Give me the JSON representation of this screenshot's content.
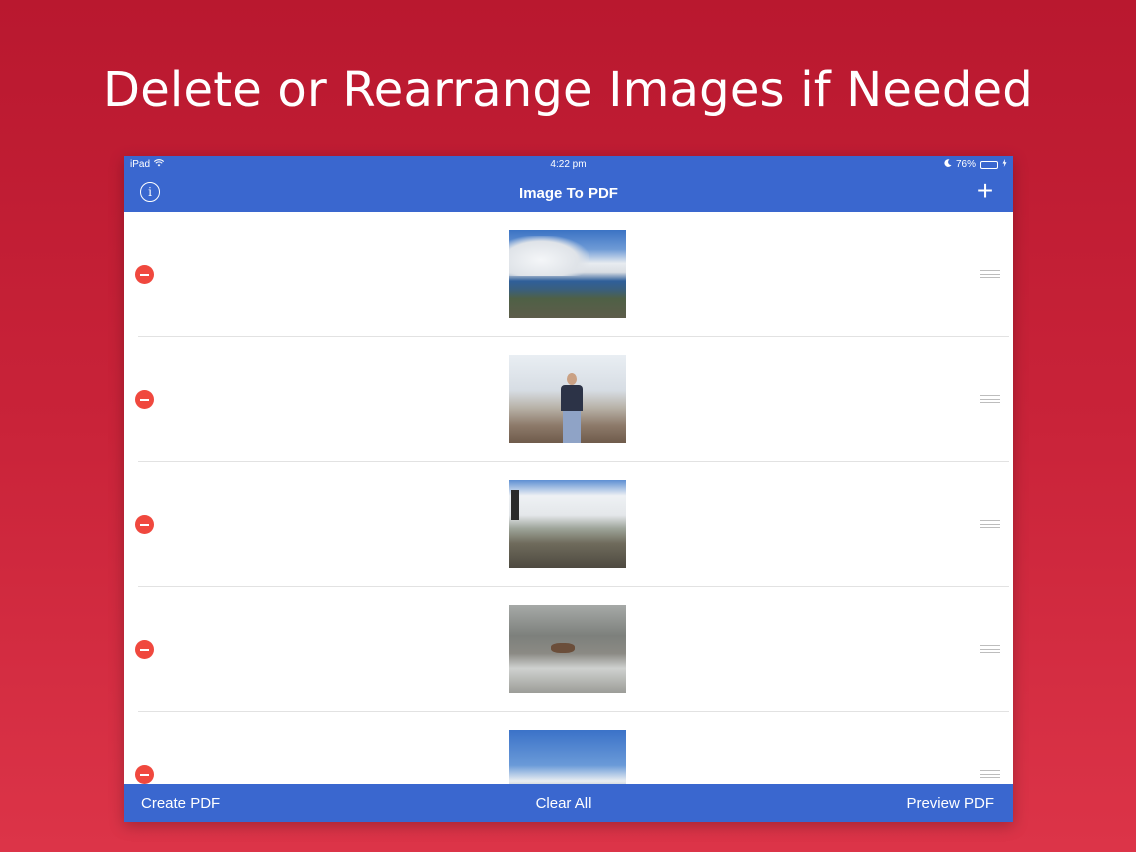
{
  "headline": "Delete or Rearrange Images if Needed",
  "statusbar": {
    "device": "iPad",
    "time": "4:22 pm",
    "battery": "76%",
    "battery_level": 0.76,
    "colors": {
      "battery_fill": "#4cd964"
    }
  },
  "navbar": {
    "title": "Image To PDF",
    "info_icon": "info-circle-icon",
    "add_icon": "plus-icon"
  },
  "list": {
    "rows": [
      {
        "image": "coastline-clouds"
      },
      {
        "image": "man-standing-on-rocks"
      },
      {
        "image": "rocky-path-clouds"
      },
      {
        "image": "gray-rocks"
      },
      {
        "image": "coast-mountains"
      }
    ],
    "delete_icon": "minus-circle-icon",
    "reorder_icon": "drag-handle-icon"
  },
  "toolbar": {
    "create": "Create PDF",
    "clear": "Clear All",
    "preview": "Preview PDF"
  },
  "colors": {
    "background": "#c92339",
    "bar": "#3a67cf",
    "delete": "#f0483e"
  }
}
